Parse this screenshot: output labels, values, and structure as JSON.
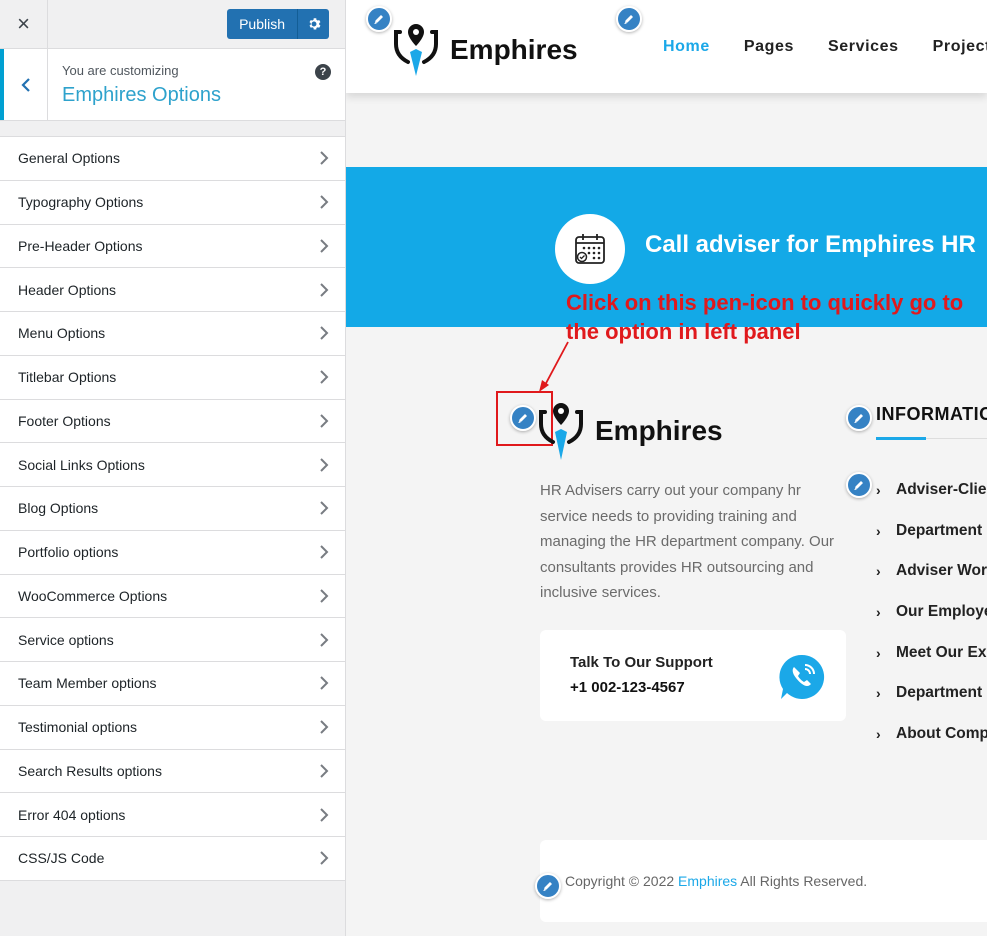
{
  "sidebar": {
    "close_icon": "×",
    "publish_label": "Publish",
    "customizing_label": "You are customizing",
    "customizing_title": "Emphires Options",
    "help_icon": "?",
    "items": [
      {
        "label": "General Options"
      },
      {
        "label": "Typography Options"
      },
      {
        "label": "Pre-Header Options"
      },
      {
        "label": "Header Options"
      },
      {
        "label": "Menu Options"
      },
      {
        "label": "Titlebar Options"
      },
      {
        "label": "Footer Options"
      },
      {
        "label": "Social Links Options"
      },
      {
        "label": "Blog Options"
      },
      {
        "label": "Portfolio options"
      },
      {
        "label": "WooCommerce Options"
      },
      {
        "label": "Service options"
      },
      {
        "label": "Team Member options"
      },
      {
        "label": "Testimonial options"
      },
      {
        "label": "Search Results options"
      },
      {
        "label": "Error 404 options"
      },
      {
        "label": "CSS/JS Code"
      }
    ]
  },
  "preview": {
    "logo_text": "Emphires",
    "nav": [
      "Home",
      "Pages",
      "Services",
      "Projects"
    ],
    "cta_text": "Call adviser for Emphires HR",
    "annotation": "Click on this pen-icon to quickly go to the option in left panel",
    "footer_logo_text": "Emphires",
    "footer_description": "HR Advisers carry out your company hr service needs to providing training and managing the HR department company. Our consultants provides HR outsourcing and inclusive services.",
    "support_label": "Talk To Our Support",
    "support_phone": "+1 002-123-4567",
    "info_title": "INFORMATION",
    "info_links": [
      {
        "label": "Adviser-Client"
      },
      {
        "label": "Department"
      },
      {
        "label": "Adviser Works"
      },
      {
        "label": "Our Employees"
      },
      {
        "label": "Meet Our Experts"
      },
      {
        "label": "Department"
      },
      {
        "label": "About Company"
      }
    ],
    "copyright_prefix": "Copyright © 2022 ",
    "copyright_brand": "Emphires",
    "copyright_suffix": " All Rights Reserved."
  },
  "colors": {
    "accent": "#1ba8e8",
    "wp_blue": "#2271b1",
    "annotation_red": "#e0191c",
    "pen_blue": "#3582c4"
  }
}
